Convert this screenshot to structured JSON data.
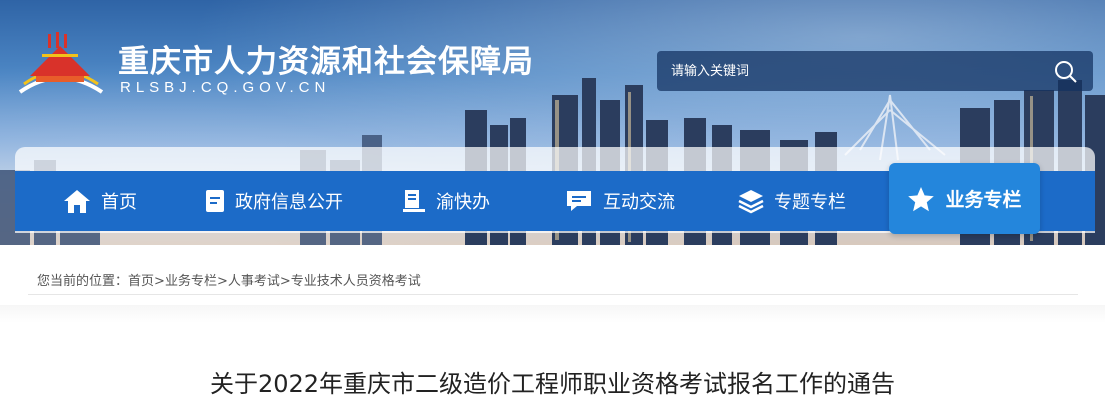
{
  "header": {
    "title": "重庆市人力资源和社会保障局",
    "subtitle": "RLSBJ.CQ.GOV.CN",
    "logo_icon": "chongqing-hall-logo-icon"
  },
  "search": {
    "placeholder": "请输入关键词",
    "icon": "search-icon"
  },
  "nav": {
    "items": [
      {
        "label": "首页",
        "icon": "home-icon"
      },
      {
        "label": "政府信息公开",
        "icon": "document-icon"
      },
      {
        "label": "渝快办",
        "icon": "book-icon"
      },
      {
        "label": "互动交流",
        "icon": "chat-icon"
      },
      {
        "label": "专题专栏",
        "icon": "layers-icon"
      },
      {
        "label": "业务专栏",
        "icon": "star-icon",
        "active": true
      }
    ]
  },
  "breadcrumb": {
    "prefix": "您当前的位置：",
    "items": [
      "首页",
      "业务专栏",
      "人事考试",
      "专业技术人员资格考试"
    ],
    "separator": ">"
  },
  "article": {
    "title": "关于2022年重庆市二级造价工程师职业资格考试报名工作的通告"
  },
  "colors": {
    "nav_bg": "#1c6bc8",
    "nav_active_bg": "#2486dc",
    "text": "#222222"
  }
}
